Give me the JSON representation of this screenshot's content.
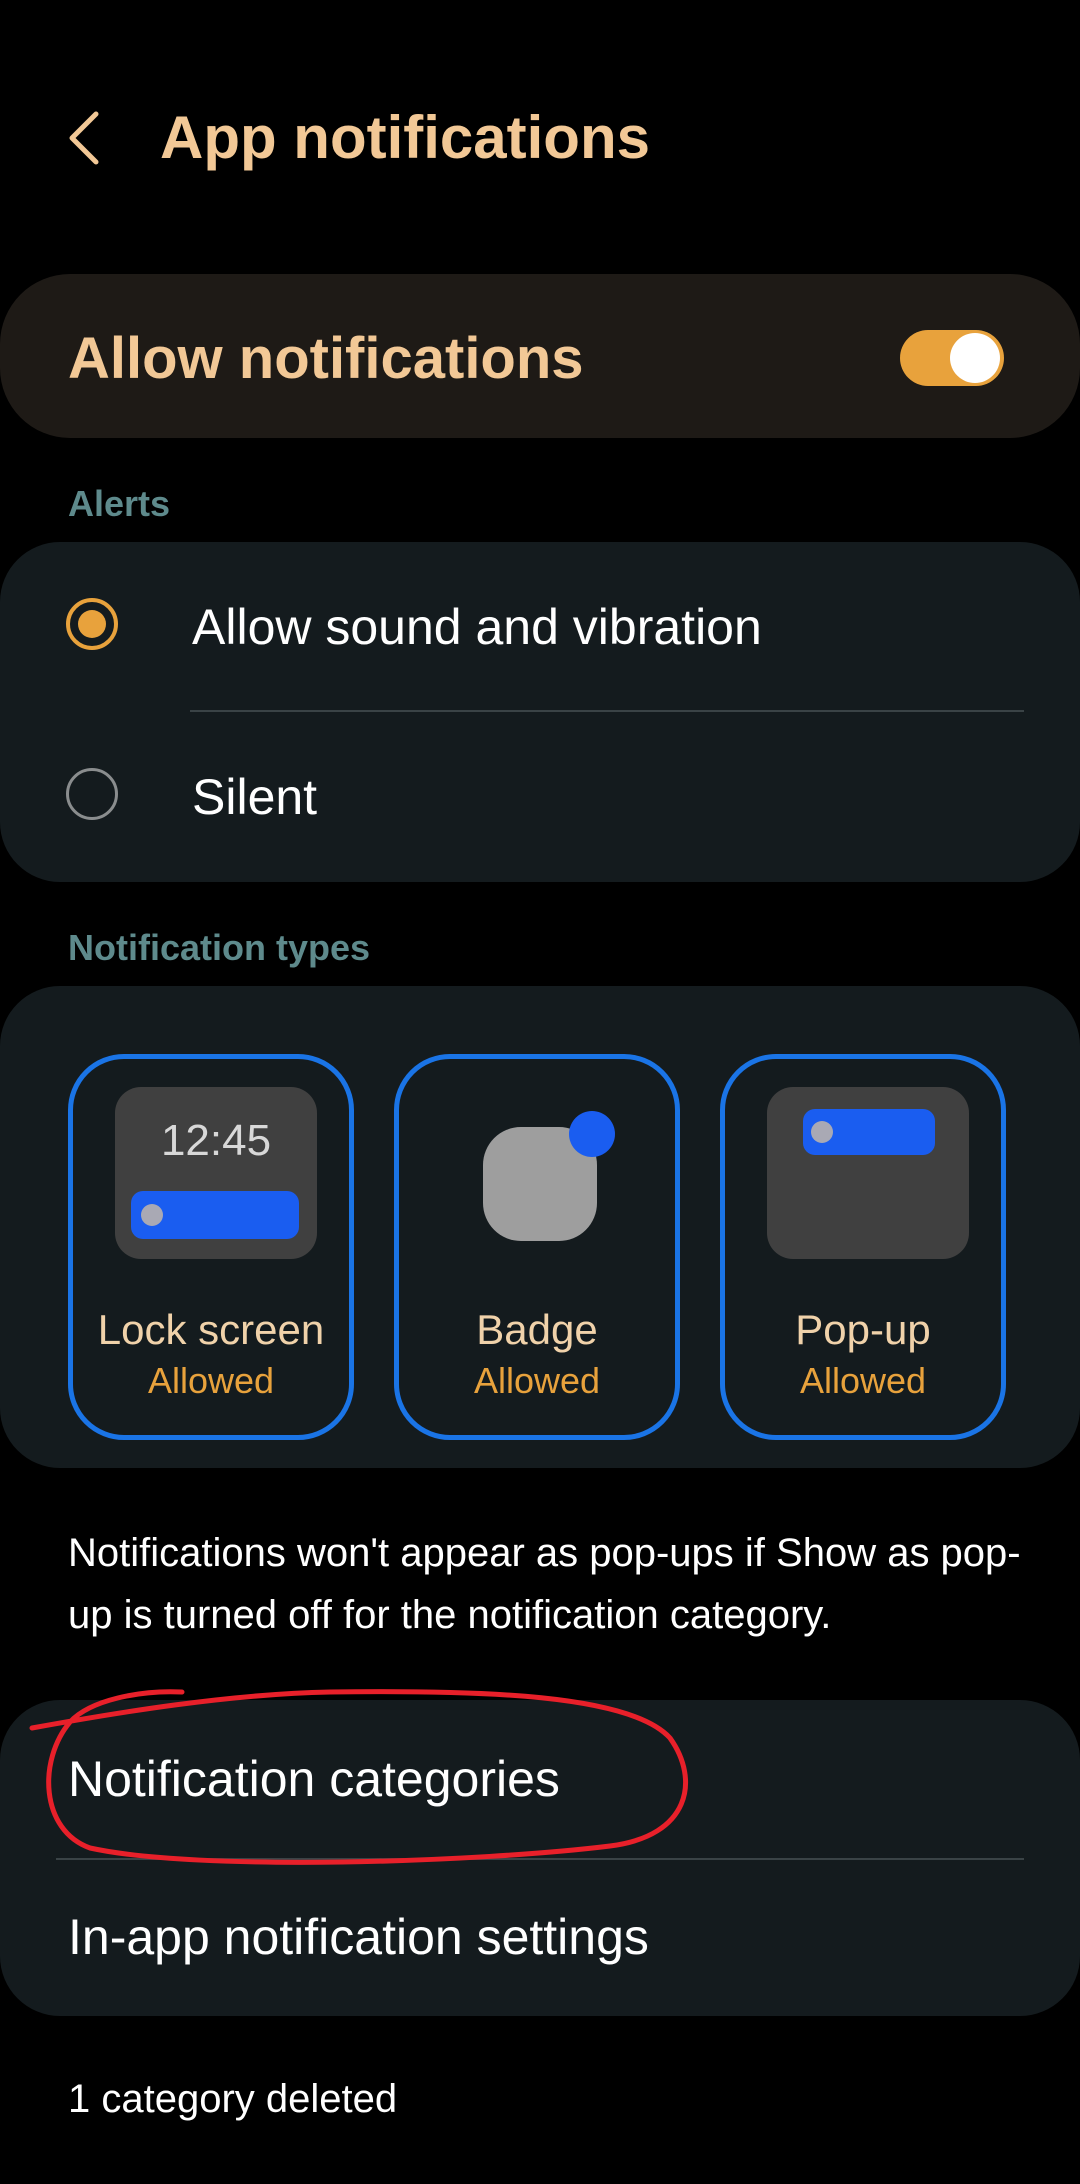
{
  "colors": {
    "accent": "#e8a23c",
    "accent_title": "#f2c896",
    "blue": "#1a74e6",
    "blue_fill": "#1a5df0",
    "tile_label": "#f0d2aa",
    "annotation": "#e8202a"
  },
  "header": {
    "title": "App notifications",
    "back_icon": "chevron-left-icon"
  },
  "allow_notifications": {
    "label": "Allow notifications",
    "enabled": true
  },
  "alerts": {
    "section_title": "Alerts",
    "options": [
      {
        "label": "Allow sound and vibration",
        "selected": true
      },
      {
        "label": "Silent",
        "selected": false
      }
    ]
  },
  "notification_types": {
    "section_title": "Notification types",
    "items": [
      {
        "label": "Lock screen",
        "status": "Allowed",
        "preview_time": "12:45"
      },
      {
        "label": "Badge",
        "status": "Allowed"
      },
      {
        "label": "Pop-up",
        "status": "Allowed"
      }
    ]
  },
  "info_text": "Notifications won't appear as pop-ups if Show as pop-up is turned off for the notification category.",
  "settings_list": [
    {
      "label": "Notification categories"
    },
    {
      "label": "In-app notification settings"
    }
  ],
  "footer_note": "1 category deleted"
}
